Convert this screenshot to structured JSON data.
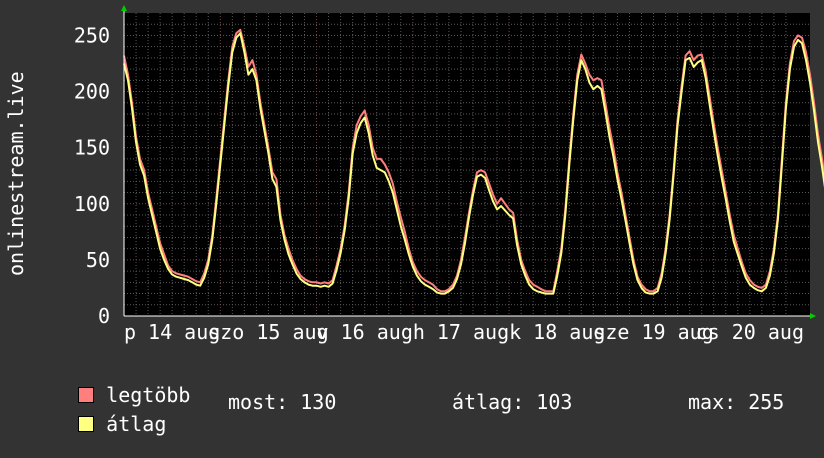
{
  "chart_data": {
    "type": "line",
    "ylabel": "onlinestream.live",
    "ylim": [
      0,
      270
    ],
    "yticks": [
      0,
      50,
      100,
      150,
      200,
      250
    ],
    "xlim": [
      0,
      171
    ],
    "x_tick_labels": [
      {
        "label": "p 14 aug",
        "at": 0
      },
      {
        "label": "szo 15 aug",
        "at": 24
      },
      {
        "label": "v 16 aug",
        "at": 48
      },
      {
        "label": "h 17 aug",
        "at": 72
      },
      {
        "label": "k 18 aug",
        "at": 96
      },
      {
        "label": "sze 19 aug",
        "at": 120
      },
      {
        "label": "cs 20 aug",
        "at": 144
      }
    ],
    "x_unit": "hours since first sample",
    "series": [
      {
        "name": "legtöbb",
        "color": "#ff7f7f",
        "values": [
          232,
          215,
          190,
          160,
          140,
          130,
          110,
          95,
          80,
          65,
          55,
          45,
          40,
          38,
          37,
          36,
          35,
          33,
          31,
          30,
          38,
          50,
          72,
          105,
          140,
          175,
          210,
          240,
          252,
          255,
          240,
          222,
          228,
          215,
          190,
          170,
          150,
          128,
          122,
          90,
          72,
          60,
          50,
          42,
          36,
          33,
          31,
          30,
          30,
          29,
          30,
          29,
          32,
          45,
          60,
          80,
          110,
          150,
          170,
          178,
          183,
          170,
          150,
          140,
          140,
          135,
          128,
          118,
          102,
          88,
          75,
          60,
          48,
          40,
          35,
          32,
          30,
          28,
          24,
          22,
          22,
          24,
          28,
          36,
          50,
          70,
          92,
          112,
          128,
          130,
          128,
          118,
          108,
          100,
          105,
          100,
          95,
          92,
          68,
          50,
          40,
          32,
          28,
          26,
          24,
          22,
          22,
          22,
          40,
          60,
          95,
          140,
          180,
          215,
          233,
          225,
          215,
          210,
          212,
          210,
          190,
          168,
          150,
          128,
          110,
          90,
          70,
          50,
          35,
          28,
          24,
          22,
          22,
          25,
          38,
          60,
          90,
          130,
          175,
          205,
          232,
          236,
          228,
          232,
          233,
          218,
          195,
          172,
          150,
          130,
          110,
          90,
          72,
          60,
          48,
          38,
          32,
          28,
          26,
          25,
          28,
          40,
          60,
          90,
          140,
          190,
          225,
          245,
          250,
          248,
          235,
          215,
          190,
          162,
          140,
          115,
          100,
          80,
          60,
          45,
          35,
          28,
          25,
          26,
          28,
          30,
          42,
          68,
          100,
          115,
          140,
          152,
          148,
          138,
          140
        ]
      },
      {
        "name": "átlag",
        "color": "#ffff80",
        "values": [
          225,
          210,
          185,
          155,
          135,
          125,
          105,
          90,
          75,
          60,
          50,
          42,
          37,
          35,
          34,
          33,
          32,
          30,
          28,
          27,
          34,
          46,
          68,
          100,
          135,
          170,
          205,
          235,
          248,
          252,
          235,
          215,
          220,
          210,
          185,
          165,
          145,
          122,
          115,
          85,
          68,
          55,
          46,
          38,
          33,
          30,
          28,
          27,
          27,
          26,
          27,
          26,
          29,
          41,
          56,
          76,
          105,
          145,
          163,
          172,
          177,
          163,
          143,
          132,
          130,
          128,
          120,
          110,
          95,
          80,
          68,
          55,
          44,
          36,
          31,
          28,
          26,
          24,
          21,
          20,
          20,
          22,
          25,
          33,
          46,
          65,
          88,
          108,
          124,
          126,
          123,
          112,
          102,
          95,
          98,
          94,
          90,
          87,
          63,
          46,
          36,
          28,
          24,
          22,
          21,
          20,
          20,
          20,
          36,
          56,
          90,
          135,
          175,
          210,
          228,
          220,
          208,
          202,
          205,
          202,
          182,
          160,
          142,
          122,
          104,
          85,
          65,
          46,
          32,
          25,
          21,
          20,
          20,
          22,
          34,
          56,
          86,
          126,
          170,
          200,
          228,
          230,
          222,
          226,
          228,
          212,
          188,
          165,
          143,
          123,
          104,
          84,
          66,
          55,
          44,
          34,
          28,
          25,
          23,
          22,
          25,
          36,
          56,
          86,
          135,
          185,
          220,
          240,
          246,
          243,
          228,
          208,
          183,
          155,
          133,
          108,
          93,
          74,
          55,
          41,
          31,
          24,
          22,
          23,
          25,
          27,
          38,
          64,
          96,
          110,
          135,
          146,
          142,
          132,
          130
        ]
      }
    ],
    "grid": true,
    "legend_position": "bottom-left"
  },
  "legend": {
    "items": [
      {
        "label": "legtöbb",
        "color": "#ff7f7f"
      },
      {
        "label": "átlag",
        "color": "#ffff80"
      }
    ]
  },
  "stats": {
    "most": "most: 130",
    "atlag": "átlag: 103",
    "max": "max: 255"
  },
  "colors": {
    "background": "#333333",
    "plot_background": "#000000",
    "grid_minor": "#5a5a5a",
    "grid_major": "#7a4a4a",
    "axis": "#ffffff",
    "arrow": "#00cc00"
  }
}
